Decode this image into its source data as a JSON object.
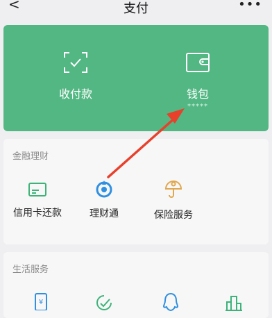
{
  "header": {
    "back_icon": "chevron-left-icon",
    "title": "支付",
    "more_icon": "more-dots-icon"
  },
  "pay_panel": {
    "items": [
      {
        "label": "收付款",
        "icon": "scan-qr-icon"
      },
      {
        "label": "钱包",
        "icon": "wallet-icon",
        "sub": "*****"
      }
    ]
  },
  "finance": {
    "title": "金融理财",
    "items": [
      {
        "label": "信用卡还款",
        "icon": "credit-card-icon"
      },
      {
        "label": "理财通",
        "icon": "licaitong-icon"
      },
      {
        "label": "保险服务",
        "icon": "umbrella-icon"
      }
    ]
  },
  "life": {
    "title": "生活服务",
    "icons": [
      "phone-recharge-icon",
      "check-leaf-icon",
      "qq-penguin-icon",
      "city-service-icon"
    ]
  },
  "colors": {
    "accent": "#52b782",
    "arrow": "#e8402b"
  }
}
